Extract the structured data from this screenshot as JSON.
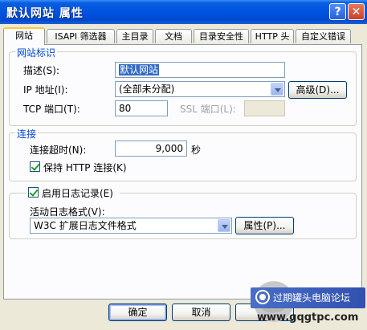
{
  "window": {
    "title": "默认网站 属性",
    "help_glyph": "?",
    "close_glyph": "✕"
  },
  "tabs": [
    {
      "label": "网站",
      "active": true
    },
    {
      "label": "ISAPI 筛选器"
    },
    {
      "label": "主目录"
    },
    {
      "label": "文档"
    },
    {
      "label": "目录安全性"
    },
    {
      "label": "HTTP 头"
    },
    {
      "label": "自定义错误"
    }
  ],
  "identity": {
    "group_title": "网站标识",
    "description_label": "描述(S):",
    "description_value": "默认网站",
    "ip_label": "IP 地址(I):",
    "ip_value": "(全部未分配)",
    "advanced_button": "高级(D)...",
    "tcp_label": "TCP 端口(T):",
    "tcp_value": "80",
    "ssl_label": "SSL 端口(L):",
    "ssl_value": ""
  },
  "connection": {
    "group_title": "连接",
    "timeout_label": "连接超时(N):",
    "timeout_value": "9,000",
    "timeout_unit": "秒",
    "keepalive_label": "保持 HTTP 连接(K)",
    "keepalive_checked": true
  },
  "logging": {
    "enable_label": "启用日志记录(E)",
    "enable_checked": true,
    "format_label": "活动日志格式(V):",
    "format_value": "W3C 扩展日志文件格式",
    "properties_button": "属性(P)..."
  },
  "footer": {
    "ok_button": "确定",
    "cancel_button": "取消"
  },
  "watermark": {
    "text": "过期罐头电脑论坛",
    "url": "www.gqgtpc.com"
  }
}
